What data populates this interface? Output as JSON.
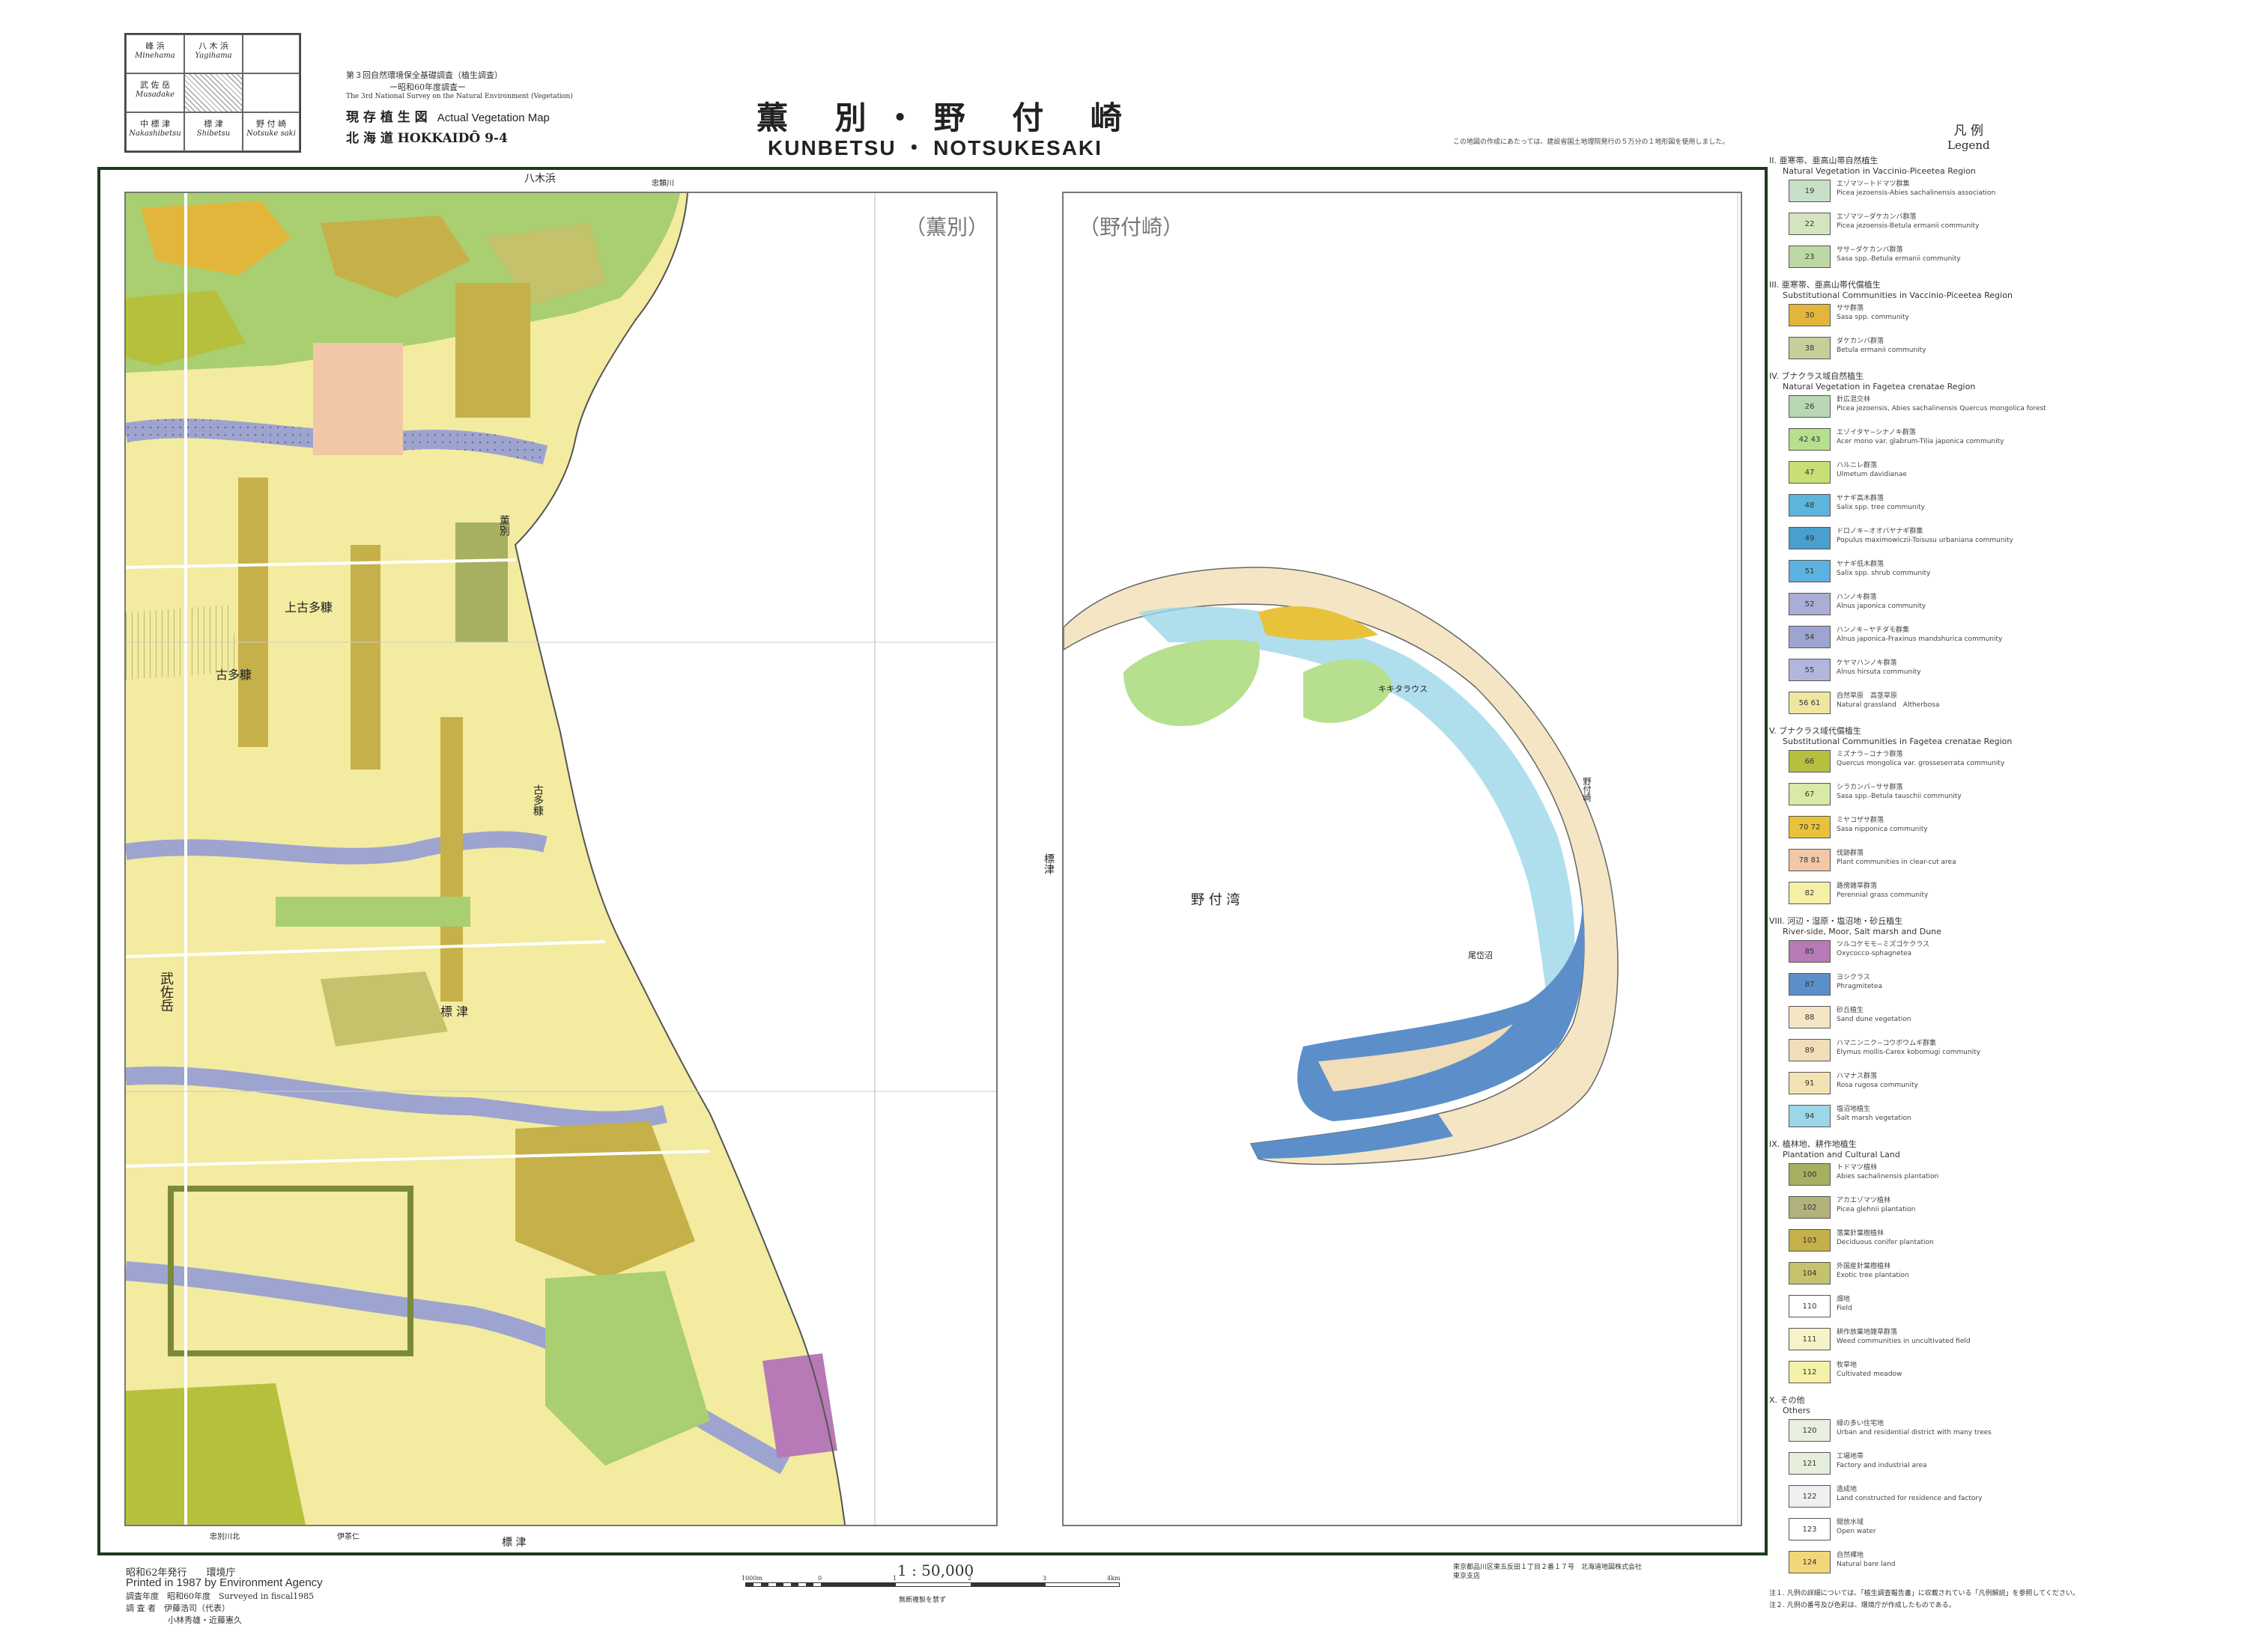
{
  "index_grid": {
    "cells": [
      {
        "jp": "峰 浜",
        "en": "Minehama"
      },
      {
        "jp": "八 木 浜",
        "en": "Yagihama"
      },
      {
        "jp": "武 佐 岳",
        "en": "Musadake"
      },
      {
        "jp": "",
        "en": ""
      },
      {
        "jp": "中 標 津",
        "en": "Nakashibetsu"
      },
      {
        "jp": "標 津",
        "en": "Shibetsu"
      },
      {
        "jp": "野 付 崎",
        "en": "Notsuke saki"
      }
    ]
  },
  "header": {
    "survey_jp": "第３回自然環境保全基礎調査（植生調査）",
    "survey_year_jp": "ー昭和60年度調査ー",
    "survey_en": "The 3rd National Survey on the Natural Environment (Vegetation)",
    "map_type": "現 存 植 生 図",
    "map_type_en": "Actual Vegetation Map",
    "region": "北 海 道 HOKKAIDŌ 9-4",
    "title_jp": "薫 別・野 付 崎",
    "title_en": "KUNBETSU ・ NOTSUKESAKI",
    "legend_jp": "凡 例",
    "legend_en": "Legend",
    "note": "この地図の作成にあたっては、建設省国土地理院発行の５万分の１地形図を使用しました。"
  },
  "map": {
    "panel_left_label": "（薫別）",
    "panel_right_label": "（野付崎）",
    "top_places": [
      "八木浜",
      "忠類川"
    ],
    "bottom_places": [
      "標 津",
      "忠別川北",
      "伊茶仁",
      "標津"
    ],
    "left_places": [
      "武佐岳"
    ],
    "inner_places": [
      "上古多糠",
      "古多糠",
      "古多糠",
      "薫別",
      "標 津",
      "野 付 湾",
      "尾岱沼",
      "野付崎",
      "キキタラウス"
    ],
    "colors": {
      "land": "#f3eba0",
      "forest": "#a9cf70",
      "water": "#cbe5ec",
      "frame": "#1d3a1d"
    }
  },
  "legend": {
    "sections": [
      {
        "title": "II. 亜寒帯、亜高山帯自然植生",
        "title_en": "Natural Vegetation in Vaccinio-Piceetea Region",
        "items": [
          {
            "code": "19",
            "color": "#c8e0c8",
            "jp": "エゾマツ−トドマツ群集",
            "en": "Picea jezoensis-Abies sachalinensis association"
          },
          {
            "code": "22",
            "color": "#d4e4c0",
            "jp": "エゾマツ−ダケカンバ群落",
            "en": "Picea jezoensis-Betula ermanii community"
          },
          {
            "code": "23",
            "color": "#bcd8a4",
            "jp": "ササ−ダケカンバ群落",
            "en": "Sasa spp.-Betula ermanii community"
          }
        ]
      },
      {
        "title": "III. 亜寒帯、亜高山帯代償植生",
        "title_en": "Substitutional Communities in Vaccinio-Piceetea Region",
        "items": [
          {
            "code": "30",
            "color": "#e2b63a",
            "jp": "ササ群落",
            "en": "Sasa spp. community"
          },
          {
            "code": "38",
            "color": "#c4cf9a",
            "jp": "ダケカンバ群落",
            "en": "Betula ermanii community"
          }
        ]
      },
      {
        "title": "IV. ブナクラス域自然植生",
        "title_en": "Natural Vegetation in Fagetea crenatae Region",
        "items": [
          {
            "code": "26",
            "color": "#b9d7b4",
            "jp": "針広混交林",
            "en": "Picea jezoensis, Abies sachalinensis Quercus mongolica forest"
          },
          {
            "code": "42 43",
            "color": "#b6e08e",
            "jp": "エゾイタヤ−シナノキ群落",
            "en": "Acer mono var. glabrum-Tilia japonica community"
          },
          {
            "code": "47",
            "color": "#c7df74",
            "jp": "ハルニレ群落",
            "en": "Ulmetum davidianae"
          },
          {
            "code": "48",
            "color": "#5db4dc",
            "jp": "ヤナギ高木群落",
            "en": "Salix spp. tree community"
          },
          {
            "code": "49",
            "color": "#4a9fcf",
            "jp": "ドロノキ−オオバヤナギ群集",
            "en": "Populus maximowiczii-Toisusu urbaniana community"
          },
          {
            "code": "51",
            "color": "#5bb1e0",
            "jp": "ヤナギ低木群落",
            "en": "Salix spp. shrub community"
          },
          {
            "code": "52",
            "color": "#a9aed6",
            "jp": "ハンノキ群落",
            "en": "Alnus japonica community"
          },
          {
            "code": "54",
            "color": "#9ea4d0",
            "jp": "ハンノキ−ヤチダモ群集",
            "en": "Alnus japonica-Fraxinus mandshurica community"
          },
          {
            "code": "55",
            "color": "#b3b6dc",
            "jp": "ケヤマハンノキ群落",
            "en": "Alnus hirsuta community"
          },
          {
            "code": "56 61",
            "color": "#f0e6a0",
            "jp": "自然草原　高茎草原",
            "en": "Natural grassland　Altherbosa"
          }
        ]
      },
      {
        "title": "V. ブナクラス域代償植生",
        "title_en": "Substitutional Communities in Fagetea crenatae Region",
        "items": [
          {
            "code": "66",
            "color": "#b6c03c",
            "jp": "ミズナラ−コナラ群落",
            "en": "Quercus mongolica var. grosseserrata community"
          },
          {
            "code": "67",
            "color": "#d9e9a8",
            "jp": "シラカンバ−ササ群落",
            "en": "Sasa spp.-Betula tauschii community"
          },
          {
            "code": "70 72",
            "color": "#e9c23c",
            "jp": "ミヤコザサ群落",
            "en": "Sasa nipponica community"
          },
          {
            "code": "78 81",
            "color": "#f2c7a8",
            "jp": "伐跡群落",
            "en": "Plant communities in clear-cut area"
          },
          {
            "code": "82",
            "color": "#f6f0a6",
            "jp": "路傍雑草群落",
            "en": "Perennial grass community"
          }
        ]
      },
      {
        "title": "VIII. 河辺・湿原・塩沼地・砂丘植生",
        "title_en": "River-side, Moor, Salt marsh and Dune",
        "items": [
          {
            "code": "85",
            "color": "#b77ab6",
            "jp": "ツルコケモモ−ミズゴケクラス",
            "en": "Oxycocco-sphagnetea"
          },
          {
            "code": "87",
            "color": "#5c8fca",
            "jp": "ヨシクラス",
            "en": "Phragmitetea"
          },
          {
            "code": "88",
            "color": "#f4e6c4",
            "jp": "砂丘植生",
            "en": "Sand dune vegetation"
          },
          {
            "code": "89",
            "color": "#f1ddb8",
            "jp": "ハマニンニク−コウボウムギ群集",
            "en": "Elymus mollis-Carex kobomugi community"
          },
          {
            "code": "91",
            "color": "#f3e2b4",
            "jp": "ハマナス群落",
            "en": "Rosa rugosa community"
          },
          {
            "code": "94",
            "color": "#9bd7e8",
            "jp": "塩沼地植生",
            "en": "Salt marsh vegetation"
          }
        ]
      },
      {
        "title": "IX. 植林地、耕作地植生",
        "title_en": "Plantation and Cultural Land",
        "items": [
          {
            "code": "100",
            "color": "#a6b060",
            "jp": "トドマツ植林",
            "en": "Abies sachalinensis plantation"
          },
          {
            "code": "102",
            "color": "#b1b27c",
            "jp": "アカエゾマツ植林",
            "en": "Picea glehnii plantation"
          },
          {
            "code": "103",
            "color": "#c6b04a",
            "jp": "落葉針葉樹植林",
            "en": "Deciduous conifer plantation"
          },
          {
            "code": "104",
            "color": "#c4c26a",
            "jp": "外国産針葉樹植林",
            "en": "Exotic tree plantation"
          },
          {
            "code": "110",
            "color": "#ffffff",
            "jp": "畑地",
            "en": "Field"
          },
          {
            "code": "111",
            "color": "#f8f2c8",
            "jp": "耕作放棄地雑草群落",
            "en": "Weed communities in uncultivated field"
          },
          {
            "code": "112",
            "color": "#f6f1a8",
            "jp": "牧草地",
            "en": "Cultivated meadow"
          }
        ]
      },
      {
        "title": "X. その他",
        "title_en": "Others",
        "items": [
          {
            "code": "120",
            "color": "#e8efe0",
            "jp": "緑の多い住宅地",
            "en": "Urban and residential district with many trees"
          },
          {
            "code": "121",
            "color": "#e6eedc",
            "jp": "工場地帯",
            "en": "Factory and industrial area"
          },
          {
            "code": "122",
            "color": "#f0f0f0",
            "jp": "造成地",
            "en": "Land constructed for residence and factory"
          },
          {
            "code": "123",
            "color": "#ffffff",
            "jp": "開放水域",
            "en": "Open water"
          },
          {
            "code": "124",
            "color": "#f3d67a",
            "jp": "自然裸地",
            "en": "Natural bare land"
          }
        ]
      }
    ],
    "notes": [
      "注１. 凡例の詳細については、「植生調査報告書」に収載されている「凡例解説」を参照してください。",
      "注２. 凡例の番号及び色彩は、環境庁が作成したものである。"
    ]
  },
  "footer": {
    "published_jp": "昭和62年発行　　環境庁",
    "published_en": "Printed in 1987 by Environment Agency",
    "survey_year": "調査年度　昭和60年度　Surveyed in fiscal1985",
    "surveyors": "調 査 者　伊藤浩司（代表）",
    "surveyors2": "小林秀雄・近藤憲久",
    "scale": "1 : 50,000",
    "scale_note": "無断複製を禁ず",
    "scale_ticks": [
      "1000m",
      "0",
      "1",
      "2",
      "3",
      "4km"
    ],
    "printer": "東京都品川区東五反田１丁目２番１７号　北海道地図株式会社東京支店"
  }
}
